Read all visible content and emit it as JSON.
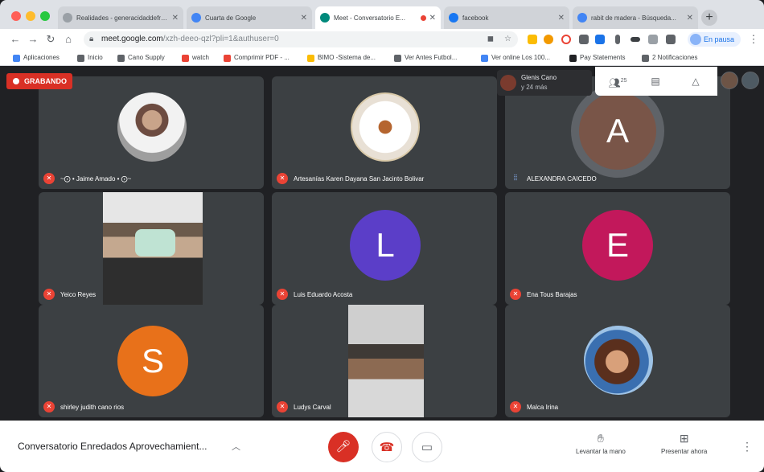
{
  "browser": {
    "tabs": [
      {
        "title": "Realidades - generacidaddefro...",
        "color": "#9aa0a6",
        "active": false
      },
      {
        "title": "Cuarta de Google",
        "color": "#4285f4",
        "active": false
      },
      {
        "title": "Meet - Conversatorio E...",
        "color": "#00897b",
        "active": true
      },
      {
        "title": "facebook",
        "color": "#1877f2",
        "active": false
      },
      {
        "title": "rabit de madera - Búsqueda...",
        "color": "#4285f4",
        "active": false
      }
    ],
    "url": {
      "host": "meet.google.com",
      "path": "/xzh-deeo-qzl?pli=1&authuser=0"
    },
    "profile_label": "En pausa",
    "bookmarks": [
      {
        "label": "Aplicaciones",
        "color": "#4285f4"
      },
      {
        "label": "Inicio",
        "color": "#5f6368"
      },
      {
        "label": "Cano Supply",
        "color": "#5f6368"
      },
      {
        "label": "watch",
        "color": "#ea4335"
      },
      {
        "label": "Comprimir PDF - ...",
        "color": "#ea4335"
      },
      {
        "label": "BIMO -Sistema de...",
        "color": "#fbbc04"
      },
      {
        "label": "Ver Antes Futbol...",
        "color": "#5f6368"
      },
      {
        "label": "Ver online Los 100...",
        "color": "#4285f4"
      },
      {
        "label": "Pay Statements",
        "color": "#202124"
      },
      {
        "label": "2 Notificaciones",
        "color": "#5f6368"
      }
    ]
  },
  "meet": {
    "recording_label": "GRABANDO",
    "presenter": {
      "name": "Glenis Cano",
      "more": "y 24 más"
    },
    "participants_count": "25",
    "participants": [
      {
        "name": "~⨀ • Jaime Amado • ⨀~",
        "kind": "photo",
        "mic": "off"
      },
      {
        "name": "Artesanías Karen Dayana San Jacinto Bolivar",
        "kind": "logo",
        "mic": "off"
      },
      {
        "name": "ALEXANDRA CAICEDO",
        "kind": "letter",
        "letter": "A",
        "color": "#795548",
        "mic": "on"
      },
      {
        "name": "Yeico Reyes",
        "kind": "camera",
        "mic": "off"
      },
      {
        "name": "Luis Eduardo Acosta",
        "kind": "letter",
        "letter": "L",
        "color": "#5b3ec8",
        "mic": "off"
      },
      {
        "name": "Ena Tous Barajas",
        "kind": "letter",
        "letter": "E",
        "color": "#c2185b",
        "mic": "off"
      },
      {
        "name": "shirley judith cano rios",
        "kind": "letter",
        "letter": "S",
        "color": "#e8711a",
        "mic": "off"
      },
      {
        "name": "Ludys Carval",
        "kind": "camera",
        "mic": "off"
      },
      {
        "name": "Malca Irina",
        "kind": "photo",
        "mic": "off"
      }
    ],
    "meeting_title": "Conversatorio Enredados Aprovechamient...",
    "raise_hand_label": "Levantar la mano",
    "present_label": "Presentar ahora"
  }
}
